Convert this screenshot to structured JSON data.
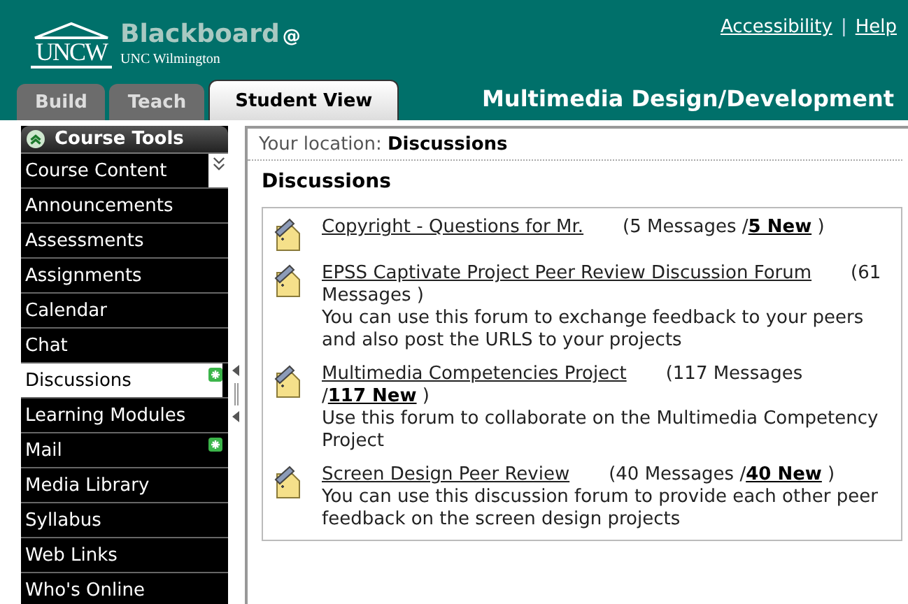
{
  "header": {
    "logo_text": "UNCW",
    "brand": "Blackboard",
    "brand_mark": "@",
    "subtitle": "UNC Wilmington",
    "links": [
      "Accessibility",
      "Help"
    ],
    "separator": "|",
    "course_title": "Multimedia Design/Development"
  },
  "tabs": [
    {
      "label": "Build",
      "selected": false
    },
    {
      "label": "Teach",
      "selected": false
    },
    {
      "label": "Student View",
      "selected": true
    }
  ],
  "sidebar": {
    "title": "Course Tools",
    "items": [
      {
        "label": "Course Content",
        "selected": false,
        "expandable": true,
        "new": false
      },
      {
        "label": "Announcements",
        "selected": false,
        "expandable": false,
        "new": false
      },
      {
        "label": "Assessments",
        "selected": false,
        "expandable": false,
        "new": false
      },
      {
        "label": "Assignments",
        "selected": false,
        "expandable": false,
        "new": false
      },
      {
        "label": "Calendar",
        "selected": false,
        "expandable": false,
        "new": false
      },
      {
        "label": "Chat",
        "selected": false,
        "expandable": false,
        "new": false
      },
      {
        "label": "Discussions",
        "selected": true,
        "expandable": false,
        "new": true
      },
      {
        "label": "Learning Modules",
        "selected": false,
        "expandable": false,
        "new": false
      },
      {
        "label": "Mail",
        "selected": false,
        "expandable": false,
        "new": true
      },
      {
        "label": "Media Library",
        "selected": false,
        "expandable": false,
        "new": false
      },
      {
        "label": "Syllabus",
        "selected": false,
        "expandable": false,
        "new": false
      },
      {
        "label": "Web Links",
        "selected": false,
        "expandable": false,
        "new": false
      },
      {
        "label": "Who's Online",
        "selected": false,
        "expandable": false,
        "new": false
      }
    ]
  },
  "breadcrumb": {
    "label": "Your location:",
    "current": "Discussions"
  },
  "heading": "Discussions",
  "forums": [
    {
      "title": "Copyright - Questions for Mr.",
      "count": "(5 Messages /",
      "new_link": "5 New",
      "count_end": ")"
    },
    {
      "title": "EPSS Captivate Project Peer Review Discussion Forum",
      "count": "(61 Messages )",
      "description": "You can use this forum to exchange feedback to your peers and also post the URLS to your projects"
    },
    {
      "title": "Multimedia Competencies Project",
      "count": "(117 Messages /",
      "new_link": "117 New",
      "count_end": ")",
      "description": "Use this forum to collaborate on the Multimedia Competency Project"
    },
    {
      "title": "Screen Design Peer Review",
      "count": "(40 Messages /",
      "new_link": "40 New",
      "count_end": ")",
      "description": "You can use this discussion forum to provide each other peer feedback on the screen design projects"
    }
  ]
}
